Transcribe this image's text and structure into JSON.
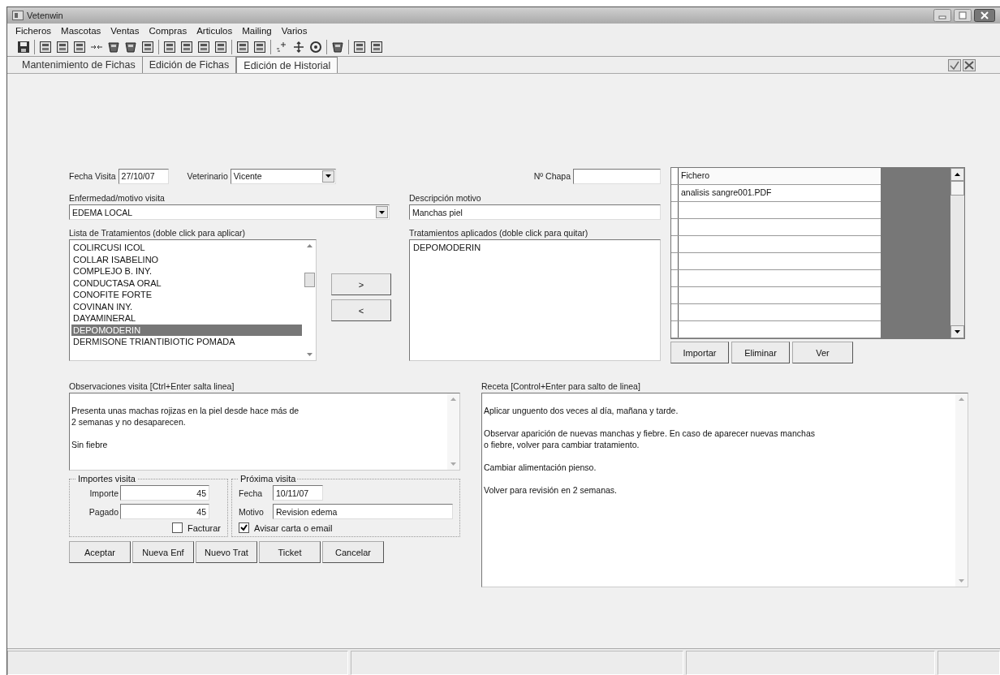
{
  "window": {
    "title": "Vetenwin"
  },
  "menu": [
    "Ficheros",
    "Mascotas",
    "Ventas",
    "Compras",
    "Articulos",
    "Mailing",
    "Varios"
  ],
  "tabs": [
    {
      "label": "Mantenimiento de Fichas",
      "selected": false
    },
    {
      "label": "Edición de Fichas",
      "selected": false
    },
    {
      "label": "Edición de Historial",
      "selected": true
    }
  ],
  "visit": {
    "date_label": "Fecha Visita",
    "date": "27/10/07",
    "vet_label": "Veterinario",
    "vet": "Vicente",
    "chapa_label": "Nº Chapa",
    "illness_label": "Enfermedad/motivo visita",
    "illness": "EDEMA LOCAL",
    "description_label": "Descripción motivo",
    "description": "Manchas piel"
  },
  "treatments": {
    "label": "Lista de Tratamientos (doble click para aplicar)",
    "items": [
      {
        "name": "COLIRCUSI ICOL",
        "selected": false
      },
      {
        "name": "COLLAR ISABELINO",
        "selected": false
      },
      {
        "name": "COMPLEJO B. INY.",
        "selected": false
      },
      {
        "name": "CONDUCTASA ORAL",
        "selected": false
      },
      {
        "name": "CONOFITE FORTE",
        "selected": false
      },
      {
        "name": "COVINAN INY.",
        "selected": false
      },
      {
        "name": "DAYAMINERAL",
        "selected": false
      },
      {
        "name": "DEPOMODERIN",
        "selected": true
      },
      {
        "name": "DERMISONE TRIANTIBIOTIC POMADA",
        "selected": false
      }
    ]
  },
  "move_buttons": [
    ">",
    "<"
  ],
  "applied": {
    "label": "Tratamientos aplicados (doble click para quitar)",
    "items": [
      "DEPOMODERIN"
    ]
  },
  "files": {
    "columns": [
      "Fichero"
    ],
    "rows": [
      [
        "analisis sangre001.PDF"
      ]
    ],
    "buttons": [
      "Importar",
      "Eliminar",
      "Ver"
    ]
  },
  "observations": {
    "label": "Observaciones visita [Ctrl+Enter salta linea]",
    "paragraphs": [
      "Presenta unas machas rojizas en la piel desde hace más de\n2 semanas y no desaparecen.",
      "Sin fiebre"
    ]
  },
  "amounts": {
    "title": "Importes visita",
    "importe_label": "Importe",
    "importe": "45",
    "pagado_label": "Pagado",
    "pagado": "45",
    "invoice_label": "Facturar",
    "invoice_checked": false
  },
  "next_visit": {
    "title": "Próxima visita",
    "date_label": "Fecha",
    "date": "10/11/07",
    "reason_label": "Motivo",
    "reason": "Revision edema",
    "notify_label": "Avisar carta o email",
    "notify_checked": true
  },
  "actions": [
    "Aceptar",
    "Nueva Enf",
    "Nuevo Trat",
    "Ticket",
    "Cancelar"
  ],
  "prescription": {
    "label": "Receta [Control+Enter para salto de linea]",
    "paragraphs": [
      "Aplicar unguento dos veces al día, mañana y tarde.",
      "Observar aparición de nuevas manchas y fiebre. En caso de aparecer nuevas manchas\no fiebre, volver para cambiar tratamiento.",
      "Cambiar alimentación pienso.",
      "Volver para revisión en 2 semanas."
    ]
  }
}
